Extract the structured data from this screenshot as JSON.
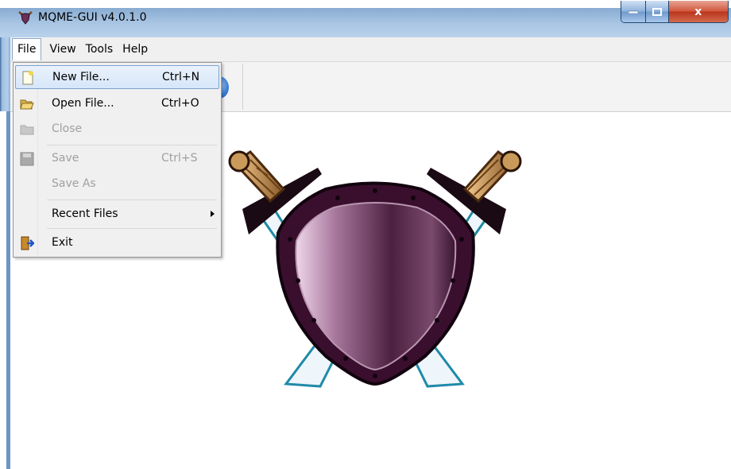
{
  "window": {
    "title": "MQME-GUI v4.0.1.0",
    "close_glyph": "x"
  },
  "menubar": {
    "items": [
      "File",
      "View",
      "Tools",
      "Help"
    ]
  },
  "file_menu": {
    "items": [
      {
        "label": "New File...",
        "shortcut": "Ctrl+N",
        "icon": "new-file-icon",
        "state": "highlighted"
      },
      {
        "label": "Open File...",
        "shortcut": "Ctrl+O",
        "icon": "folder-open-icon",
        "state": "enabled"
      },
      {
        "label": "Close",
        "shortcut": "",
        "icon": "folder-icon",
        "state": "disabled"
      },
      {
        "label": "Save",
        "shortcut": "Ctrl+S",
        "icon": "save-disk-icon",
        "state": "disabled"
      },
      {
        "label": "Save As",
        "shortcut": "",
        "icon": "",
        "state": "disabled"
      },
      {
        "label": "Recent Files",
        "shortcut": "",
        "icon": "",
        "state": "enabled",
        "submenu": true
      },
      {
        "label": "Exit",
        "shortcut": "",
        "icon": "exit-door-icon",
        "state": "enabled"
      }
    ]
  },
  "colors": {
    "menu_highlight_border": "#7da2ce",
    "shield": "#5a2a4a",
    "disabled_text": "#a0a0a0"
  }
}
